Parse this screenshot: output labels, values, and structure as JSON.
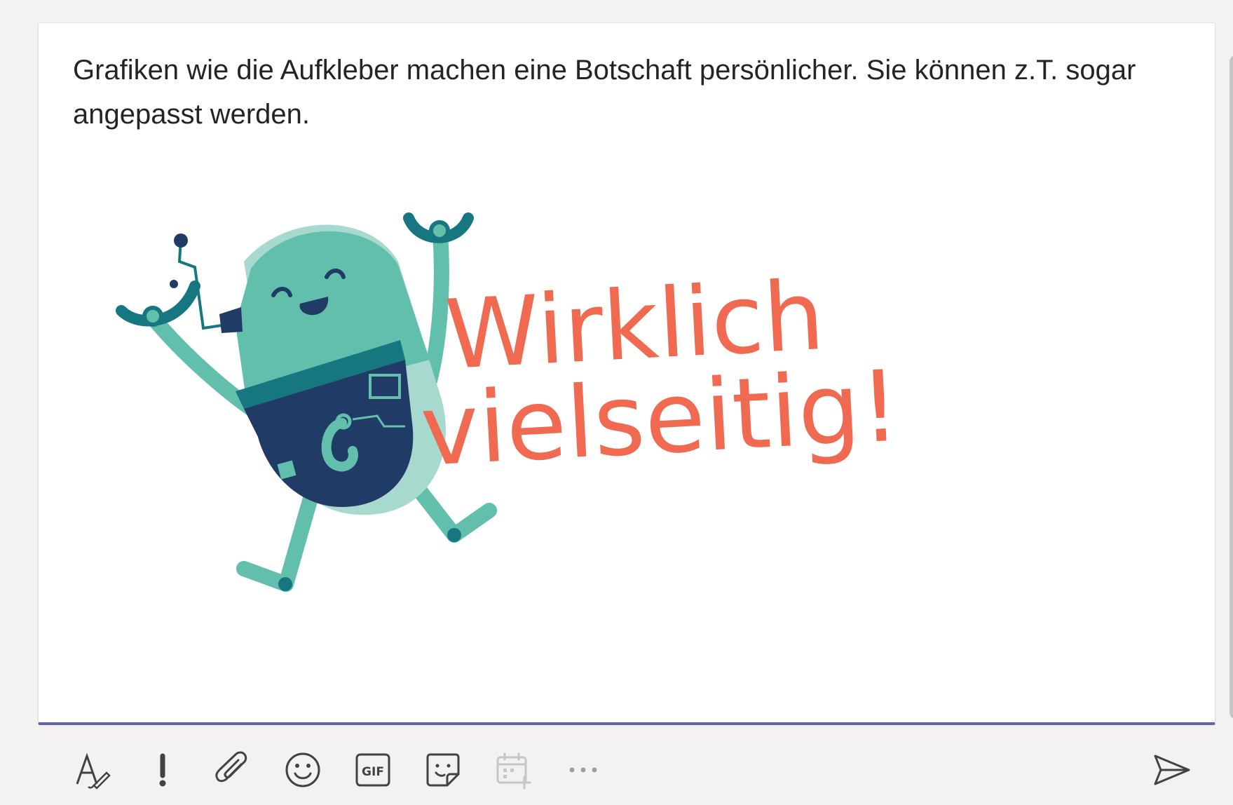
{
  "message": {
    "text": "Grafiken wie die Aufkleber machen eine Botschaft persönlicher. Sie können z.T. sogar angepasst werden."
  },
  "sticker": {
    "caption_line1": "Wirklich",
    "caption_line2": "vielseitig!",
    "colors": {
      "caption": "#ef6a50",
      "body_teal": "#62bfac",
      "body_navy": "#203b66",
      "dark_teal": "#167780"
    }
  },
  "toolbar": {
    "icons": [
      "format-icon",
      "important-icon",
      "attach-icon",
      "emoji-icon",
      "gif-icon",
      "sticker-icon",
      "schedule-meeting-icon",
      "more-options-icon",
      "send-icon"
    ]
  },
  "colors": {
    "accent": "#6264a7",
    "background": "#f3f2f1",
    "text": "#252423",
    "icon": "#424242",
    "icon_disabled": "#c8c6c4"
  }
}
